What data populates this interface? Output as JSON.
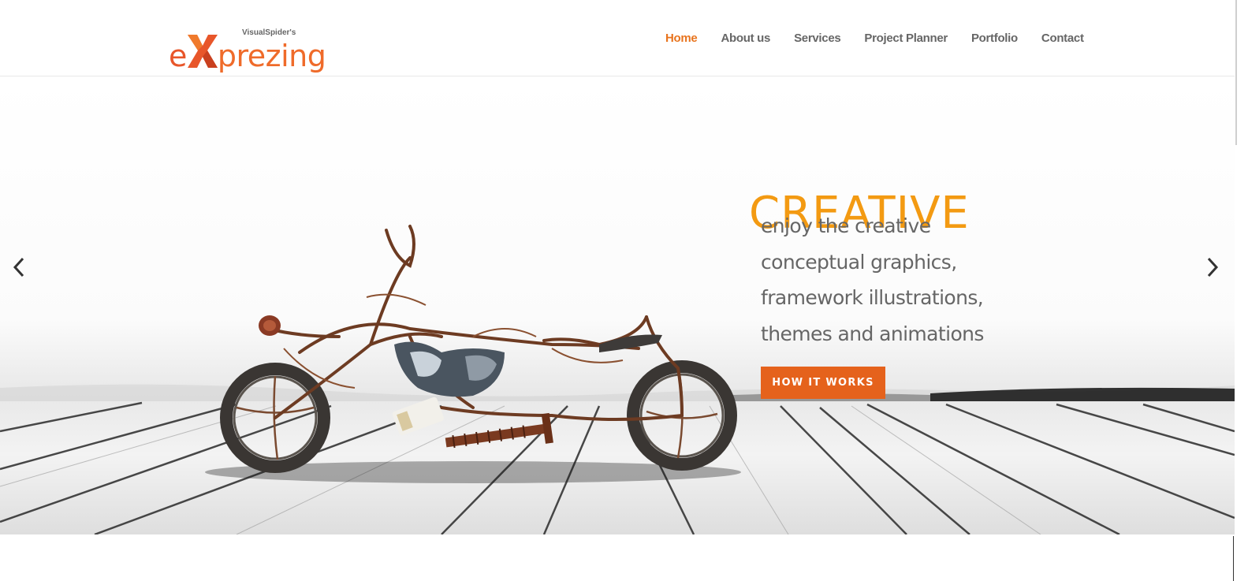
{
  "logo": {
    "tagline": "VisualSpider's",
    "prefix": "e",
    "suffix": "prezing",
    "brand_color": "#e8562a",
    "icon": "x-logo-icon"
  },
  "nav": {
    "items": [
      {
        "label": "Home",
        "active": true
      },
      {
        "label": "About us",
        "active": false
      },
      {
        "label": "Services",
        "active": false
      },
      {
        "label": "Project Planner",
        "active": false
      },
      {
        "label": "Portfolio",
        "active": false
      },
      {
        "label": "Contact",
        "active": false
      }
    ],
    "active_color": "#e8741e",
    "color": "#666666"
  },
  "slider": {
    "heading": "CREATIVE",
    "heading_color": "#f39a12",
    "lines": [
      "enjoy the creative",
      "conceptual graphics,",
      "framework illustrations,",
      "themes and animations"
    ],
    "cta_label": "HOW IT WORKS",
    "cta_color": "#e5621c",
    "prev_icon": "chevron-left-icon",
    "next_icon": "chevron-right-icon",
    "image": "wire-motorcycle-on-wooden-floor"
  }
}
